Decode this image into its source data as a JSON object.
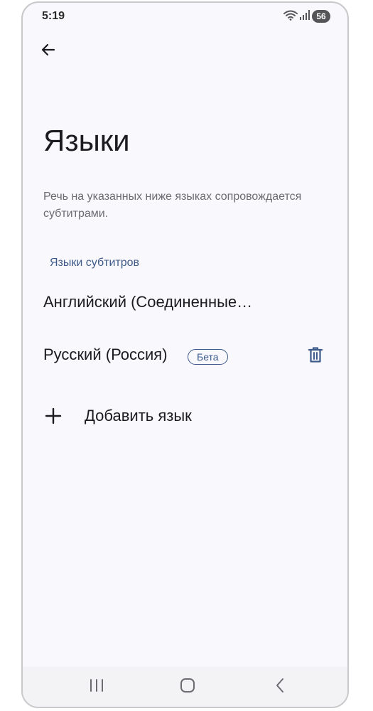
{
  "status_bar": {
    "time": "5:19",
    "battery_level": "56"
  },
  "header": {
    "back_icon": "arrow-left-icon",
    "title": "Языки"
  },
  "description": "Речь на указанных ниже языках сопровождается субтитрами.",
  "section": {
    "header": "Языки субтитров",
    "items": [
      {
        "label": "Английский (Соединенные…"
      },
      {
        "label": "Русский (Россия)",
        "badge": "Бета",
        "action_icon": "trash-icon"
      }
    ]
  },
  "add_language": {
    "icon": "plus-icon",
    "label": "Добавить язык"
  },
  "nav_bar": {
    "recents_icon": "recents-icon",
    "home_icon": "home-icon",
    "back_icon": "chevron-left-icon"
  },
  "colors": {
    "background": "#f9f8fc",
    "accent": "#3d5a8a",
    "text_primary": "#1c1b1f",
    "text_secondary": "#6c6a72"
  }
}
